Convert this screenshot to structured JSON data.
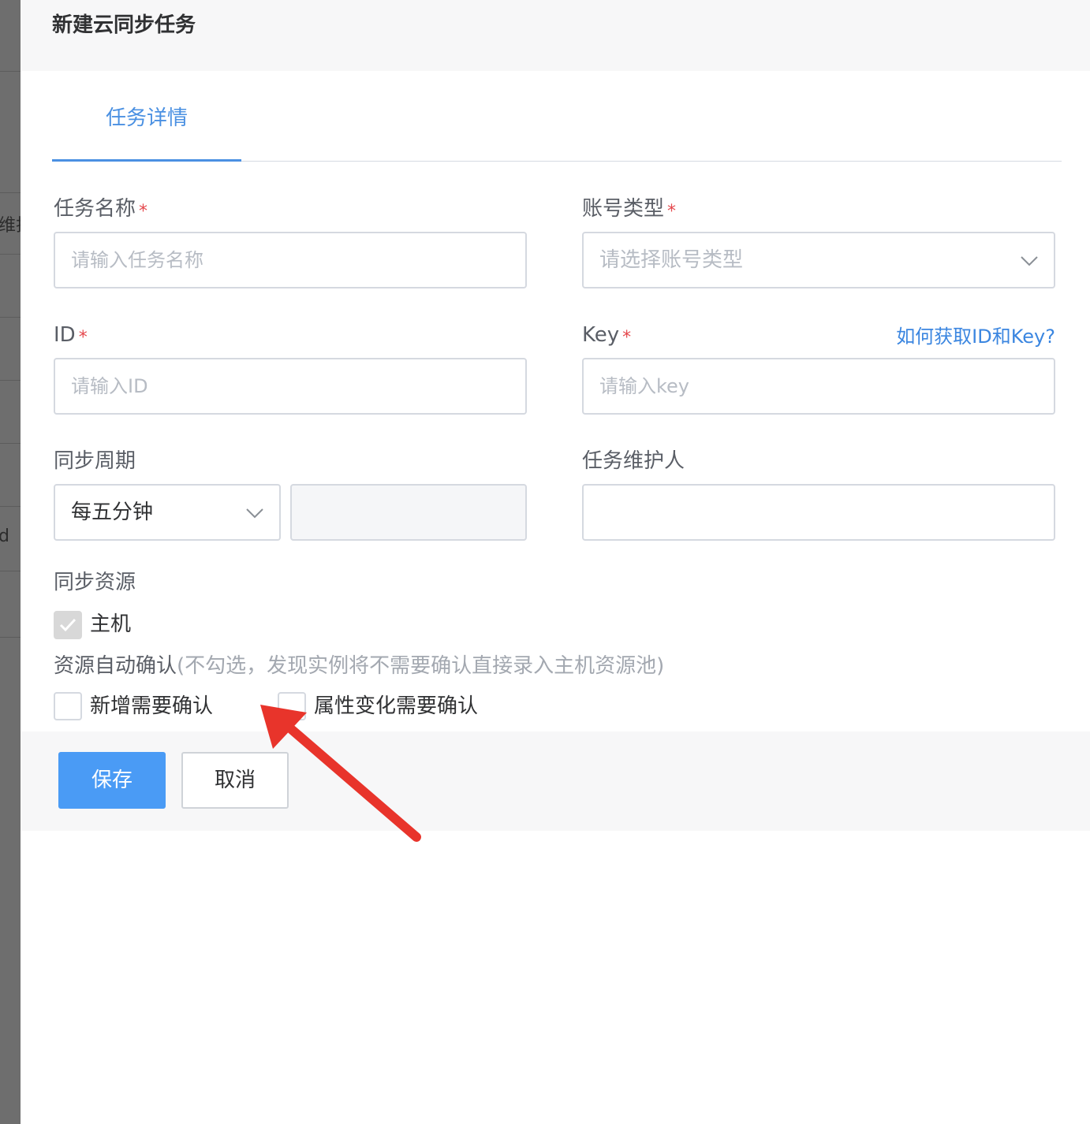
{
  "background": {
    "fragments": [
      "维护",
      "d"
    ]
  },
  "dialog": {
    "title": "新建云同步任务",
    "tab": "任务详情"
  },
  "form": {
    "task_name": {
      "label": "任务名称",
      "required_mark": "*",
      "placeholder": "请输入任务名称"
    },
    "account_type": {
      "label": "账号类型",
      "required_mark": "*",
      "placeholder": "请选择账号类型"
    },
    "id": {
      "label": "ID",
      "required_mark": "*",
      "placeholder": "请输入ID"
    },
    "key": {
      "label": "Key",
      "required_mark": "*",
      "placeholder": "请输入key",
      "help_link": "如何获取ID和Key?"
    },
    "sync_period": {
      "label": "同步周期",
      "value": "每五分钟"
    },
    "maintainer": {
      "label": "任务维护人"
    },
    "sync_resource": {
      "label": "同步资源",
      "options": [
        "主机"
      ]
    },
    "auto_confirm": {
      "label": "资源自动确认",
      "hint": "(不勾选，发现实例将不需要确认直接录入主机资源池)",
      "options": [
        "新增需要确认",
        "属性变化需要确认"
      ]
    }
  },
  "footer": {
    "save_label": "保存",
    "cancel_label": "取消"
  },
  "colors": {
    "accent": "#4a90e2",
    "required": "#e5484d",
    "annotation_arrow": "#e8342b"
  },
  "icons": {
    "chevron": "chevron-down-icon",
    "check": "check-icon",
    "arrow": "annotation-arrow-icon"
  }
}
